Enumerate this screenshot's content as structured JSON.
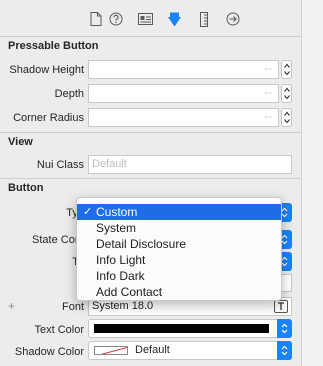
{
  "toolbar": {
    "icons": [
      "file-icon",
      "help-icon",
      "identity-icon",
      "attributes-icon",
      "size-icon",
      "connections-icon"
    ],
    "active": "attributes-icon",
    "accent": "#1a82fb"
  },
  "pressable": {
    "title": "Pressable Button",
    "shadow_height_label": "Shadow Height",
    "shadow_height_placeholder": "--",
    "depth_label": "Depth",
    "depth_placeholder": "--",
    "corner_radius_label": "Corner Radius",
    "corner_radius_placeholder": "--"
  },
  "view": {
    "title": "View",
    "nui_class_label": "Nui Class",
    "nui_class_placeholder": "Default"
  },
  "button": {
    "title": "Button",
    "type_label": "Typ",
    "state_config_label": "State Conf",
    "title_label": "Tit",
    "font_label": "Font",
    "font_value": "System 18.0",
    "text_color_label": "Text Color",
    "text_color": "#000000",
    "shadow_color_label": "Shadow Color",
    "shadow_color_value": "Default"
  },
  "type_menu": {
    "items": [
      "Custom",
      "System",
      "Detail Disclosure",
      "Info Light",
      "Info Dark",
      "Add Contact"
    ],
    "selected": "Custom",
    "check": "✓",
    "highlight": "#1f6ce9"
  }
}
